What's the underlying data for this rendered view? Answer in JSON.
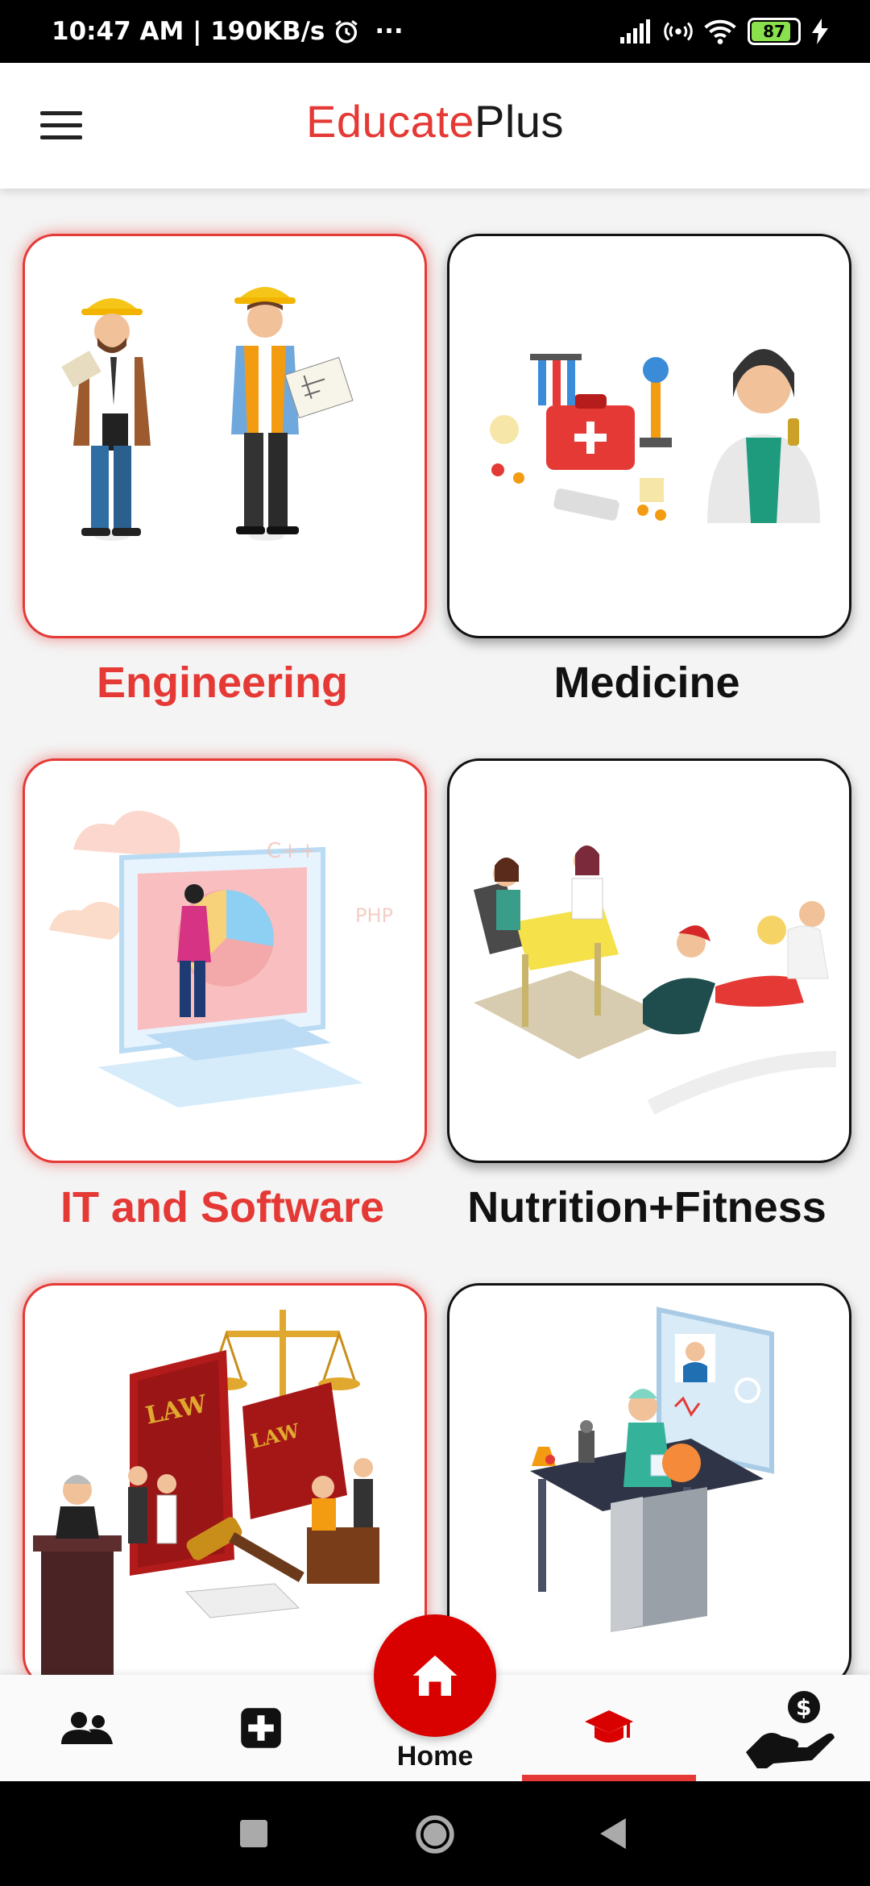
{
  "status_bar": {
    "time_speed": "10:47 AM | 190KB/s",
    "more": "···",
    "battery": "87",
    "icons": [
      "alarm-icon",
      "signal-icon",
      "hotspot-icon",
      "wifi-icon",
      "battery-icon",
      "charging-icon"
    ]
  },
  "header": {
    "brand_part1": "Educate",
    "brand_part2": "Plus",
    "menu_icon": "hamburger-menu-icon",
    "colors": {
      "accent": "#e53935",
      "dark": "#1a1a1a"
    }
  },
  "categories": [
    {
      "label": "Engineering",
      "selected": true,
      "illustration": "engineers-illustration"
    },
    {
      "label": "Medicine",
      "selected": false,
      "illustration": "doctor-illustration"
    },
    {
      "label": "IT and Software",
      "selected": true,
      "illustration": "software-illustration"
    },
    {
      "label": "Nutrition+Fitness",
      "selected": false,
      "illustration": "fitness-illustration"
    },
    {
      "label": "",
      "selected": true,
      "illustration": "law-illustration"
    },
    {
      "label": "",
      "selected": false,
      "illustration": "lab-research-illustration"
    }
  ],
  "bottom_nav": {
    "home_label": "Home",
    "items": [
      "people-icon",
      "medical-plus-icon",
      "home-icon",
      "graduation-cap-icon",
      "donate-hand-icon"
    ],
    "active": "graduation-cap-icon",
    "fab_color": "#d90000"
  },
  "system_nav": [
    "recents-square-icon",
    "home-circle-icon",
    "back-triangle-icon"
  ]
}
